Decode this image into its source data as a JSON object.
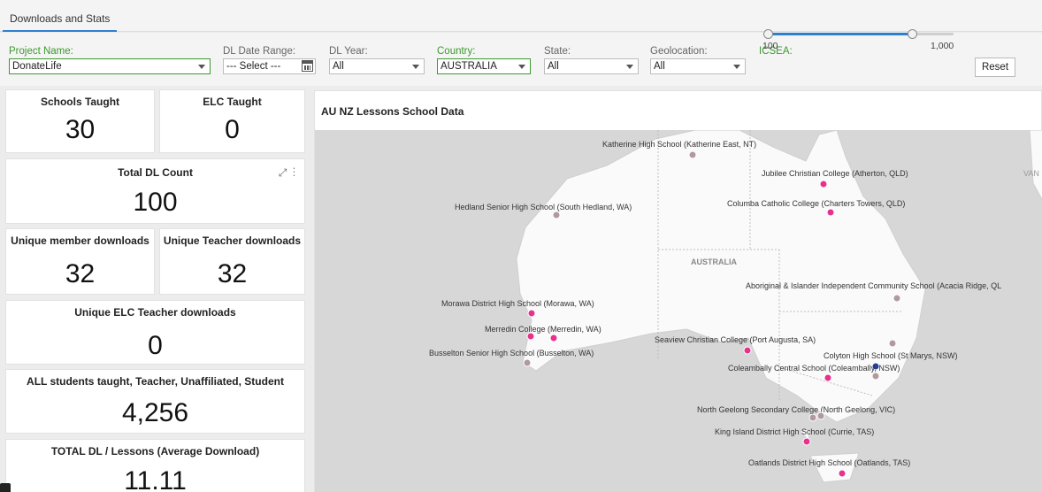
{
  "tabs": [
    {
      "label": "Downloads and Stats",
      "active": true
    }
  ],
  "filters": {
    "project_name": {
      "label": "Project Name:",
      "value": "DonateLife"
    },
    "dl_date_range": {
      "label": "DL Date Range:",
      "value": "--- Select ---"
    },
    "dl_year": {
      "label": "DL Year:",
      "value": "All"
    },
    "country": {
      "label": "Country:",
      "value": "AUSTRALIA"
    },
    "state": {
      "label": "State:",
      "value": "All"
    },
    "geolocation": {
      "label": "Geolocation:",
      "value": "All"
    },
    "icsea": {
      "label": "ICSEA:",
      "min": "100",
      "max": "1,000",
      "range_min": 100,
      "range_max": 1000,
      "low": 100,
      "high": 800
    }
  },
  "reset_label": "Reset",
  "stats": {
    "schools_taught": {
      "label": "Schools Taught",
      "value": "30"
    },
    "elc_taught": {
      "label": "ELC Taught",
      "value": "0"
    },
    "total_dl_count": {
      "label": "Total DL Count",
      "value": "100"
    },
    "unique_member_downloads": {
      "label": "Unique member downloads",
      "value": "32"
    },
    "unique_teacher_downloads": {
      "label": "Unique Teacher downloads",
      "value": "32"
    },
    "unique_elc_teacher_downloads": {
      "label": "Unique ELC Teacher downloads",
      "value": "0"
    },
    "all_students": {
      "label": "ALL students taught, Teacher, Unaffiliated, Student",
      "value": "4,256"
    },
    "total_dl_lessons": {
      "label": "TOTAL DL / Lessons (Average Download)",
      "value": "11.11"
    }
  },
  "map": {
    "title": "AU NZ Lessons School Data",
    "country_label": "AUSTRALIA",
    "edge_label": "VAN",
    "colors": {
      "pin_magenta": "#e8318c",
      "pin_grey": "#b09a9e",
      "pin_blue": "#243f9a",
      "land": "#fafafa",
      "sea": "#d7d7d7"
    },
    "schools": [
      {
        "name": "Katherine High School (Katherine East, NT)"
      },
      {
        "name": "Jubilee Christian College (Atherton, QLD)"
      },
      {
        "name": "Hedland Senior High School (South Hedland, WA)"
      },
      {
        "name": "Columba Catholic College (Charters Towers, QLD)"
      },
      {
        "name": "Aboriginal & Islander Independent Community School (Acacia Ridge, QL"
      },
      {
        "name": "Morawa District High School (Morawa, WA)"
      },
      {
        "name": "Merredin College (Merredin, WA)"
      },
      {
        "name": "Seaview Christian College (Port Augusta, SA)"
      },
      {
        "name": "Busselton Senior High School (Busselton, WA)"
      },
      {
        "name": "Colyton High School (St Marys, NSW)"
      },
      {
        "name": "Coleambally Central School (Coleambally, NSW)"
      },
      {
        "name": "North Geelong Secondary College (North Geelong, VIC)"
      },
      {
        "name": "King Island District High School (Currie, TAS)"
      },
      {
        "name": "Oatlands District High School (Oatlands, TAS)"
      }
    ]
  }
}
